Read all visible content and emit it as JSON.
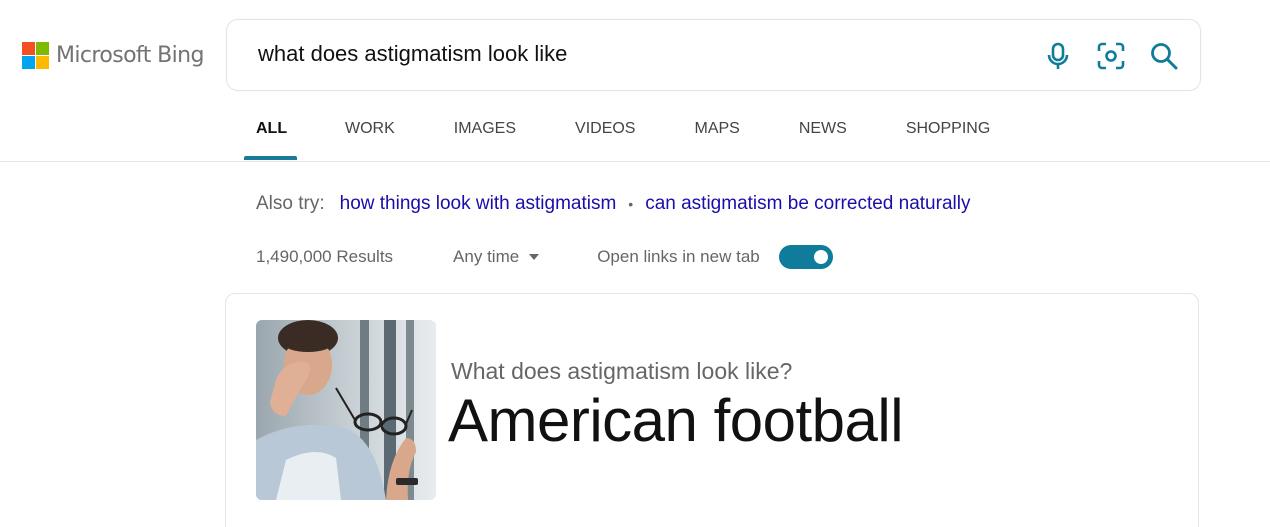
{
  "brand": {
    "name": "Microsoft Bing",
    "logo_colors": [
      "#f25022",
      "#7fba00",
      "#00a4ef",
      "#ffb900"
    ]
  },
  "search": {
    "query": "what does astigmatism look like",
    "icons": [
      "microphone-icon",
      "visual-search-icon",
      "search-icon"
    ],
    "accent": "#0f7c9b"
  },
  "tabs": [
    {
      "label": "ALL",
      "active": true
    },
    {
      "label": "WORK",
      "active": false
    },
    {
      "label": "IMAGES",
      "active": false
    },
    {
      "label": "VIDEOS",
      "active": false
    },
    {
      "label": "MAPS",
      "active": false
    },
    {
      "label": "NEWS",
      "active": false
    },
    {
      "label": "SHOPPING",
      "active": false
    }
  ],
  "also_try": {
    "label": "Also try:",
    "links": [
      "how things look with astigmatism",
      "can astigmatism be corrected naturally"
    ]
  },
  "results_bar": {
    "count": "1,490,000 Results",
    "time_filter": "Any time",
    "open_links_label": "Open links in new tab",
    "open_links_on": true
  },
  "answer_card": {
    "question": "What does astigmatism look like?",
    "answer": "American football",
    "image": "person-holding-glasses-rubbing-eyes"
  }
}
